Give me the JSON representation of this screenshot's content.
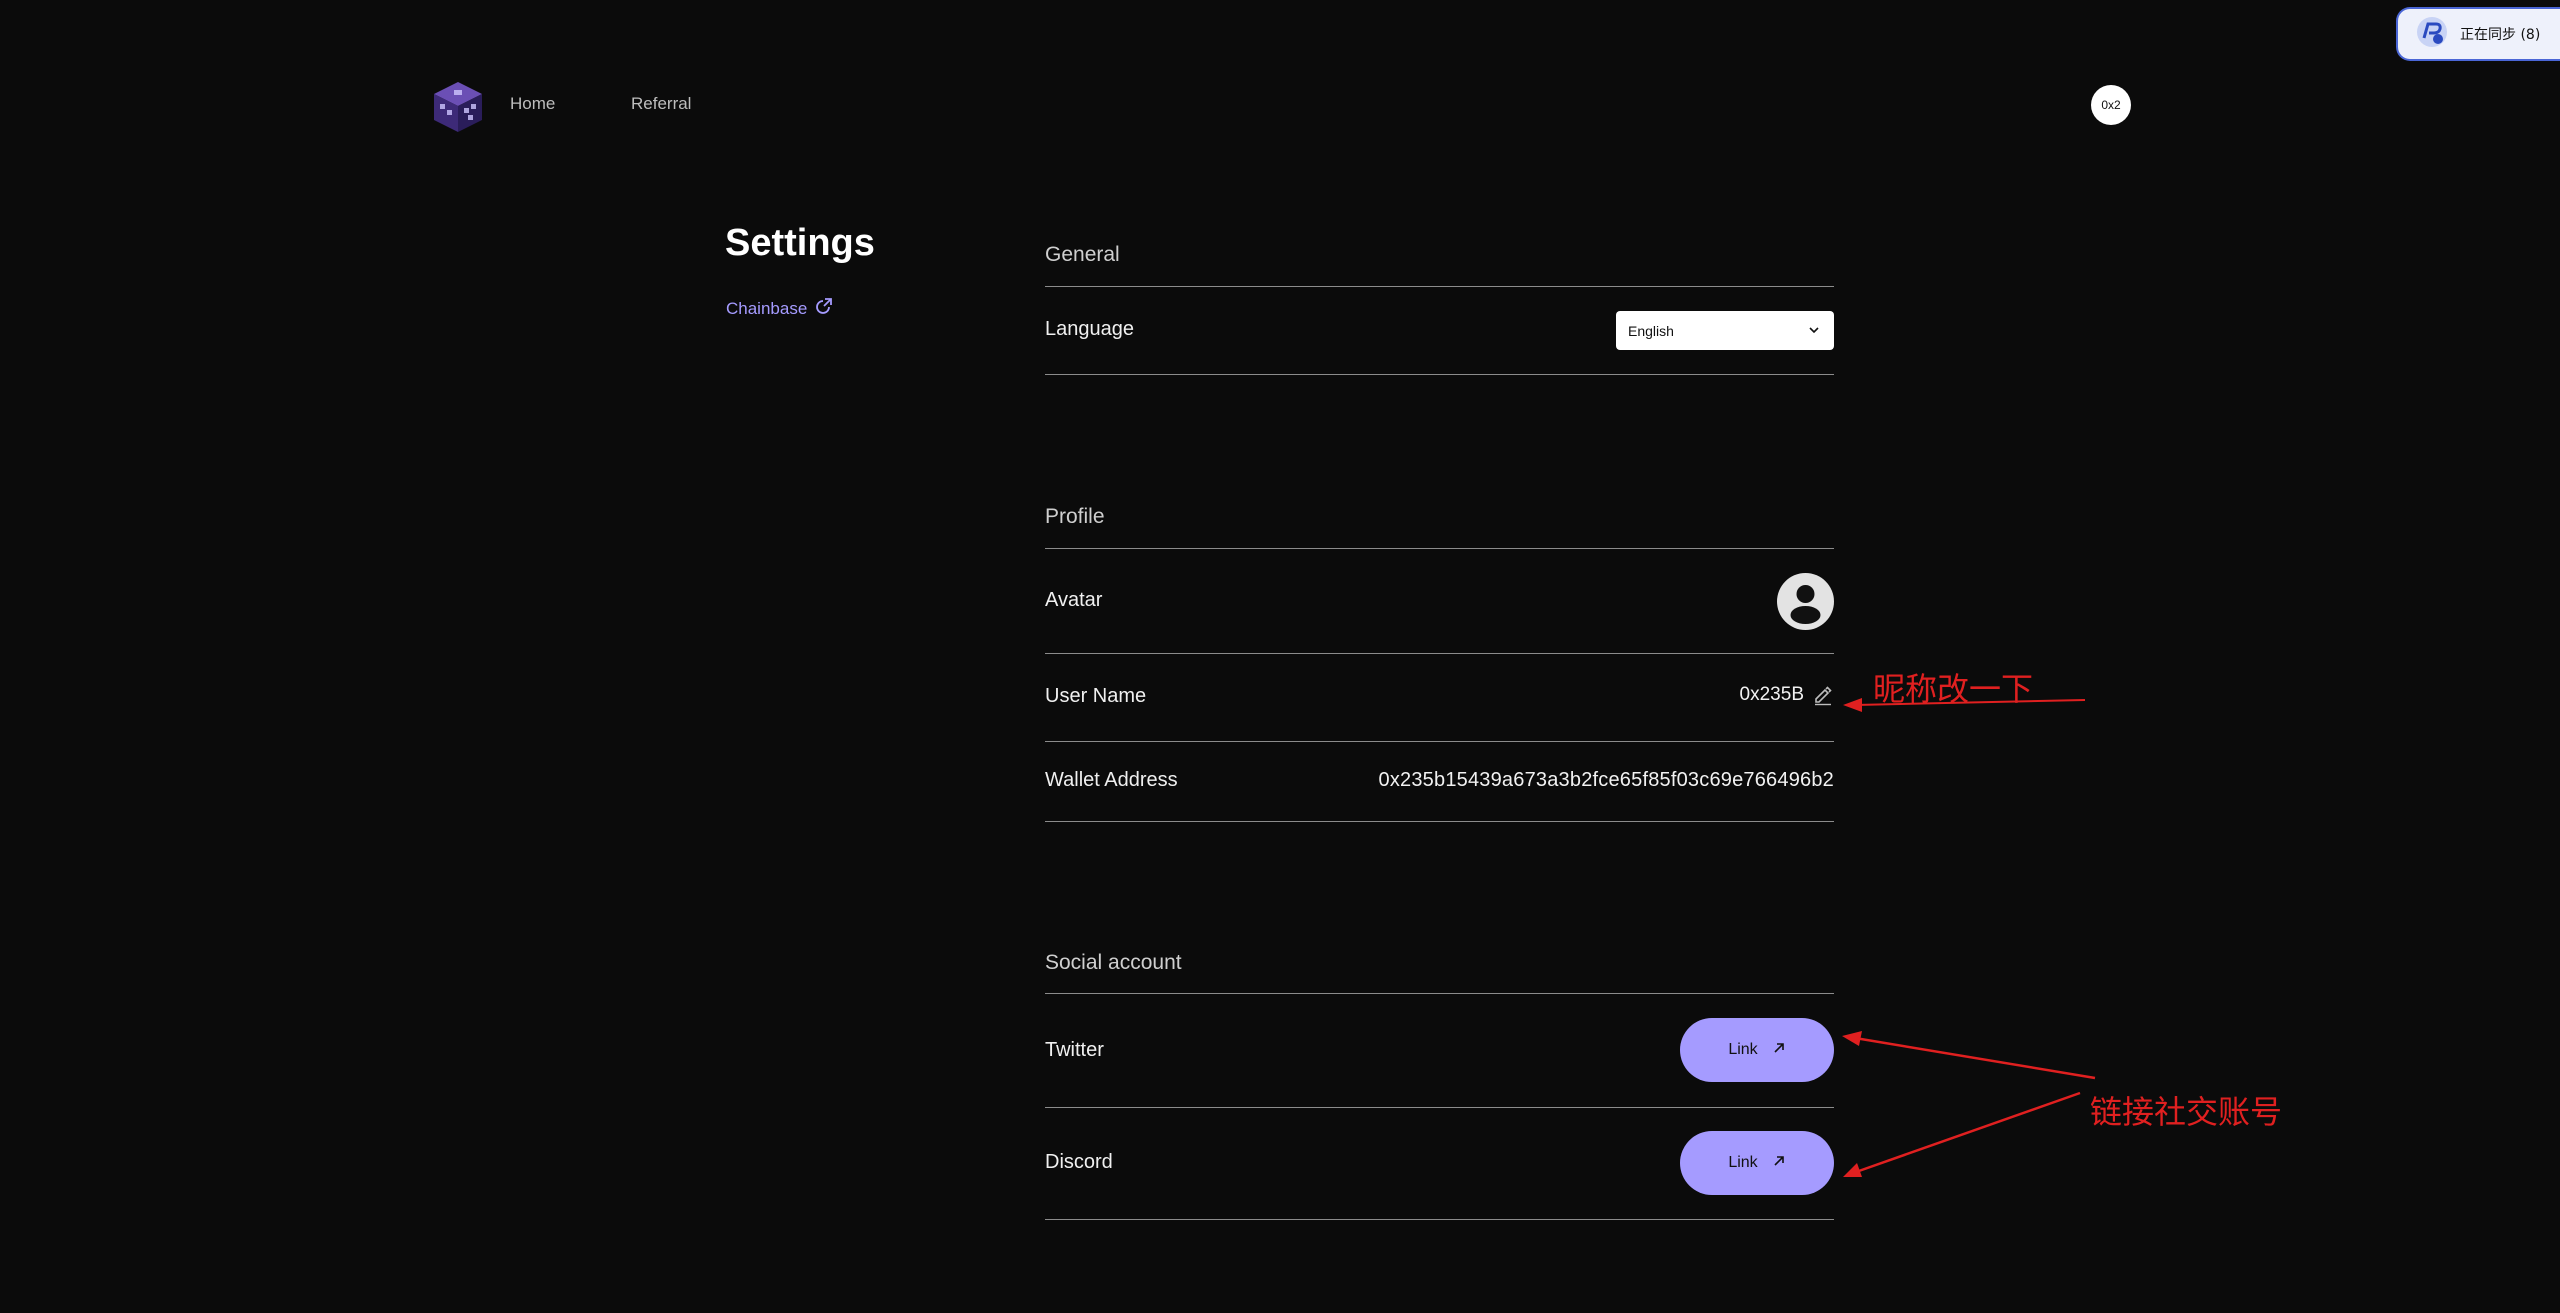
{
  "nav": {
    "home_label": "Home",
    "referral_label": "Referral",
    "account_badge": "0x2",
    "logo_icon": "cube-logo-icon"
  },
  "sync": {
    "label": "正在同步 (8)",
    "icon": "sync-avatar-icon"
  },
  "sidebar": {
    "title": "Settings",
    "link_label": "Chainbase",
    "link_icon": "external-link-icon"
  },
  "general": {
    "section_title": "General",
    "language_label": "Language",
    "language_value": "English"
  },
  "profile": {
    "section_title": "Profile",
    "avatar_label": "Avatar",
    "username_label": "User Name",
    "username_value": "0x235B",
    "wallet_label": "Wallet Address",
    "wallet_value": "0x235b15439a673a3b2fce65f85f03c69e766496b2"
  },
  "social": {
    "section_title": "Social account",
    "twitter_label": "Twitter",
    "discord_label": "Discord",
    "link_label": "Link"
  },
  "annotations": {
    "nickname_note": "昵称改一下",
    "social_note": "链接社交账号"
  },
  "colors": {
    "background": "#0b0b0b",
    "accent": "#a59bff",
    "annotation": "#e02020",
    "divider": "#8c8c8c"
  }
}
